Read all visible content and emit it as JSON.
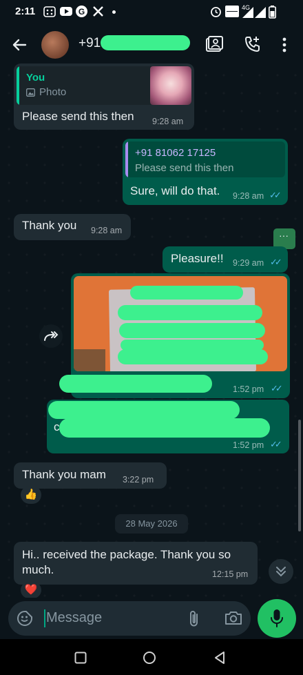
{
  "status_bar": {
    "time": "2:11",
    "network": "4G"
  },
  "header": {
    "contact_name": "+91"
  },
  "messages": {
    "m1": {
      "quote_author": "You",
      "quote_type": "Photo",
      "text": "Please send this then",
      "time": "9:28 am"
    },
    "m2": {
      "quote_author": "+91 81062 17125",
      "quote_text": "Please send this then",
      "text": "Sure, will do that.",
      "time": "9:28 am"
    },
    "m3": {
      "text": "Thank you",
      "time": "9:28 am"
    },
    "m4": {
      "text": "Pleasure!!",
      "time": "9:29 am"
    },
    "m5": {
      "time": "1:52 pm"
    },
    "m6": {
      "text_fragment": "cu",
      "time": "1:52 pm"
    },
    "m7": {
      "text": "Thank you mam",
      "time": "3:22 pm",
      "reaction": "👍"
    },
    "date_chip": "28 May 2026",
    "m8": {
      "text": "Hi.. received the package. Thank you so much.",
      "time": "12:15 pm",
      "reaction": "❤️"
    }
  },
  "composer": {
    "placeholder": "Message"
  },
  "colors": {
    "accent": "#21c063",
    "outgoing_bubble": "#005c4b",
    "incoming_bubble": "#202c33",
    "read_ticks": "#53bdeb"
  }
}
